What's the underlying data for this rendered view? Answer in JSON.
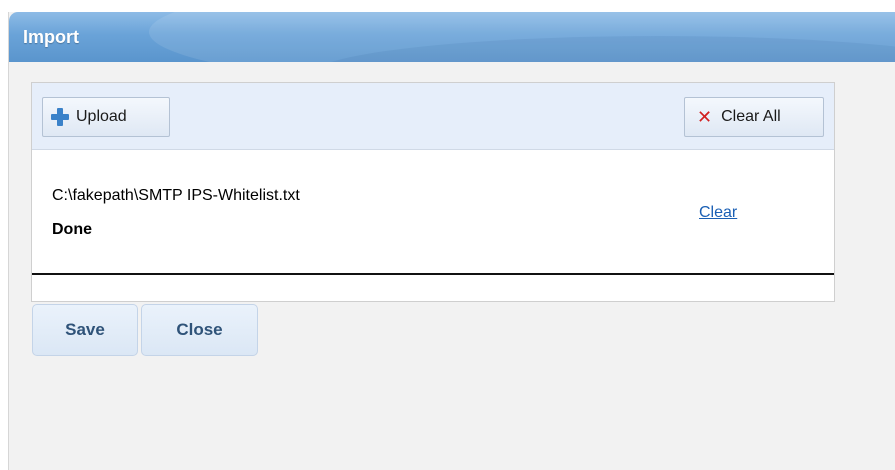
{
  "dialog": {
    "title": "Import"
  },
  "toolbar": {
    "upload_label": "Upload",
    "upload_icon": "plus-icon",
    "clear_all_label": "Clear All",
    "clear_all_icon": "close-icon"
  },
  "files": [
    {
      "path": "C:\\fakepath\\SMTP IPS-Whitelist.txt",
      "status": "Done",
      "action_label": "Clear"
    }
  ],
  "footer": {
    "save_label": "Save",
    "close_label": "Close"
  },
  "colors": {
    "title_bar": "#6aa3d8",
    "link": "#1a5fb4",
    "clear_icon": "#d22020",
    "upload_icon": "#3b82c9",
    "footer_button_text": "#2f5379"
  }
}
